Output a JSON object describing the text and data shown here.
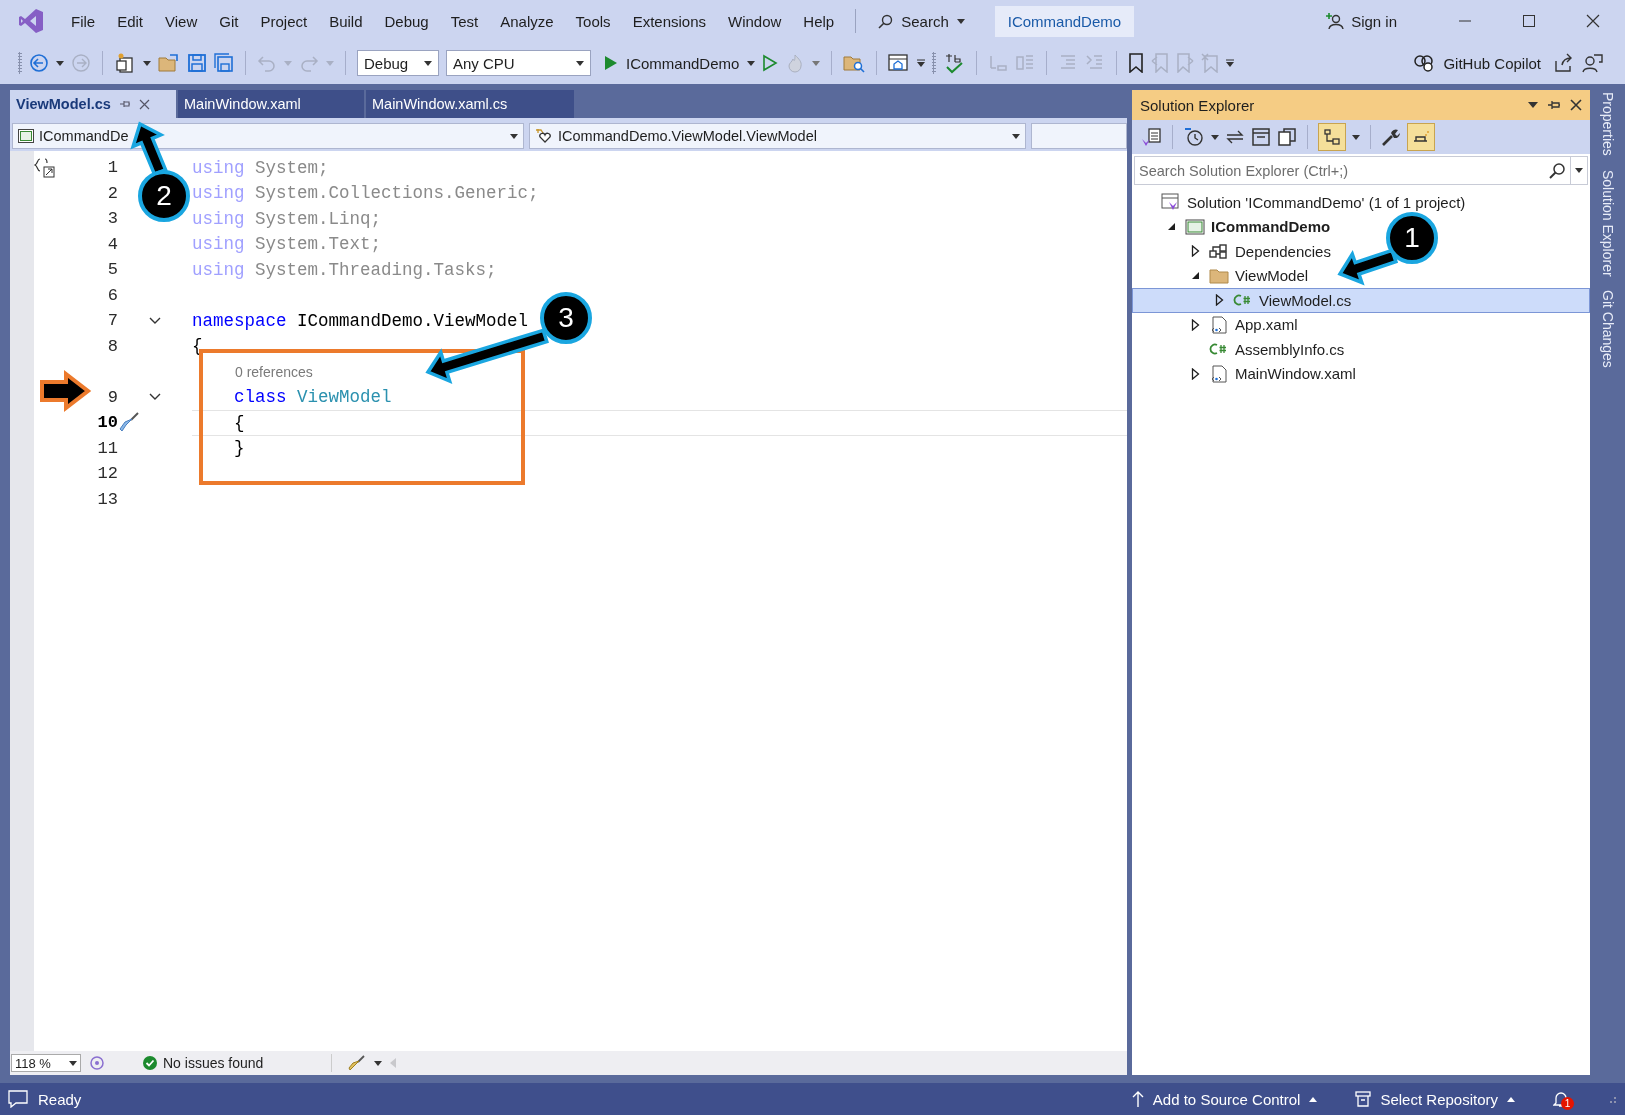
{
  "menu": [
    {
      "label": "File"
    },
    {
      "label": "Edit"
    },
    {
      "label": "View"
    },
    {
      "label": "Git"
    },
    {
      "label": "Project"
    },
    {
      "label": "Build"
    },
    {
      "label": "Debug"
    },
    {
      "label": "Test"
    },
    {
      "label": "Analyze"
    },
    {
      "label": "Tools"
    },
    {
      "label": "Extensions"
    },
    {
      "label": "Window"
    },
    {
      "label": "Help"
    }
  ],
  "search": {
    "label": "Search"
  },
  "window": {
    "title": "ICommandDemo",
    "sign_in": "Sign in"
  },
  "toolbar": {
    "configuration": "Debug",
    "platform": "Any CPU",
    "start_target": "ICommandDemo",
    "copilot": "GitHub Copilot"
  },
  "tabs": [
    {
      "label": "ViewModel.cs",
      "selected": true
    },
    {
      "label": "MainWindow.xaml",
      "selected": false
    },
    {
      "label": "MainWindow.xaml.cs",
      "selected": false
    }
  ],
  "navigation_bar": {
    "project": "ICommandDe",
    "member": "ICommandDemo.ViewModel.ViewModel"
  },
  "code_lines": [
    {
      "kind": "code",
      "number": "1",
      "foldable": false,
      "current": false,
      "segments": [
        {
          "kind": "faded-keyword",
          "text": "using"
        },
        {
          "kind": "faded",
          "text": " System;"
        }
      ]
    },
    {
      "kind": "code",
      "number": "2",
      "foldable": false,
      "current": false,
      "segments": [
        {
          "kind": "faded-keyword",
          "text": "using"
        },
        {
          "kind": "faded",
          "text": " System.Collections.Generic;"
        }
      ]
    },
    {
      "kind": "code",
      "number": "3",
      "foldable": false,
      "current": false,
      "segments": [
        {
          "kind": "faded-keyword",
          "text": "using"
        },
        {
          "kind": "faded",
          "text": " System.Linq;"
        }
      ]
    },
    {
      "kind": "code",
      "number": "4",
      "foldable": false,
      "current": false,
      "segments": [
        {
          "kind": "faded-keyword",
          "text": "using"
        },
        {
          "kind": "faded",
          "text": " System.Text;"
        }
      ]
    },
    {
      "kind": "code",
      "number": "5",
      "foldable": false,
      "current": false,
      "segments": [
        {
          "kind": "faded-keyword",
          "text": "using"
        },
        {
          "kind": "faded",
          "text": " System.Threading.Tasks;"
        }
      ]
    },
    {
      "kind": "code",
      "number": "6",
      "foldable": false,
      "current": false
    },
    {
      "kind": "code",
      "number": "7",
      "foldable": true,
      "current": false,
      "segments": [
        {
          "kind": "keyword",
          "text": "namespace"
        },
        {
          "kind": "plain",
          "text": " ICommandDemo.ViewModel"
        }
      ]
    },
    {
      "kind": "code",
      "number": "8",
      "foldable": false,
      "current": false,
      "segments": [
        {
          "kind": "plain",
          "text": "{"
        }
      ]
    },
    {
      "kind": "lens",
      "text": "0 references"
    },
    {
      "kind": "code",
      "number": "9",
      "foldable": true,
      "current": false,
      "segments": [
        {
          "kind": "keyword",
          "text": "    class"
        },
        {
          "kind": "type",
          "text": " ViewModel"
        }
      ]
    },
    {
      "kind": "code",
      "number": "10",
      "foldable": false,
      "current": true,
      "segments": [
        {
          "kind": "plain",
          "text": "    {"
        }
      ]
    },
    {
      "kind": "code",
      "number": "11",
      "foldable": false,
      "current": false,
      "segments": [
        {
          "kind": "plain",
          "text": "    }"
        }
      ]
    },
    {
      "kind": "code",
      "number": "12",
      "foldable": false,
      "current": false
    },
    {
      "kind": "code",
      "number": "13",
      "foldable": false,
      "current": false
    }
  ],
  "editor_status": {
    "zoom": "118 %",
    "issues": "No issues found"
  },
  "solution_explorer": {
    "title": "Solution Explorer",
    "search": {
      "placeholder": "Search Solution Explorer (Ctrl+;)"
    },
    "tree": [
      {
        "kind": "solution",
        "label": "Solution 'ICommandDemo' (1 of 1 project)",
        "selected": false,
        "children": [
          {
            "kind": "project",
            "label": "ICommandDemo",
            "expanded": true,
            "selected": false,
            "children": [
              {
                "kind": "dependencies",
                "label": "Dependencies",
                "expanded": false,
                "selected": false
              },
              {
                "kind": "folder",
                "label": "ViewModel",
                "expanded": true,
                "selected": false,
                "children": [
                  {
                    "kind": "csharp",
                    "label": "ViewModel.cs",
                    "expanded": false,
                    "selected": true
                  }
                ]
              },
              {
                "kind": "xaml",
                "label": "App.xaml",
                "expanded": false,
                "selected": false
              },
              {
                "kind": "csharp",
                "label": "AssemblyInfo.cs",
                "selected": false
              },
              {
                "kind": "xaml",
                "label": "MainWindow.xaml",
                "expanded": false,
                "selected": false
              }
            ]
          }
        ]
      }
    ]
  },
  "side_tabs": [
    {
      "label": "Properties"
    },
    {
      "label": "Solution Explorer"
    },
    {
      "label": "Git Changes"
    }
  ],
  "status_bar": {
    "state": "Ready",
    "source_control": "Add to Source Control",
    "repository": "Select Repository",
    "notifications": "1"
  },
  "callouts": [
    {
      "number": "1"
    },
    {
      "number": "2"
    },
    {
      "number": "3"
    }
  ]
}
